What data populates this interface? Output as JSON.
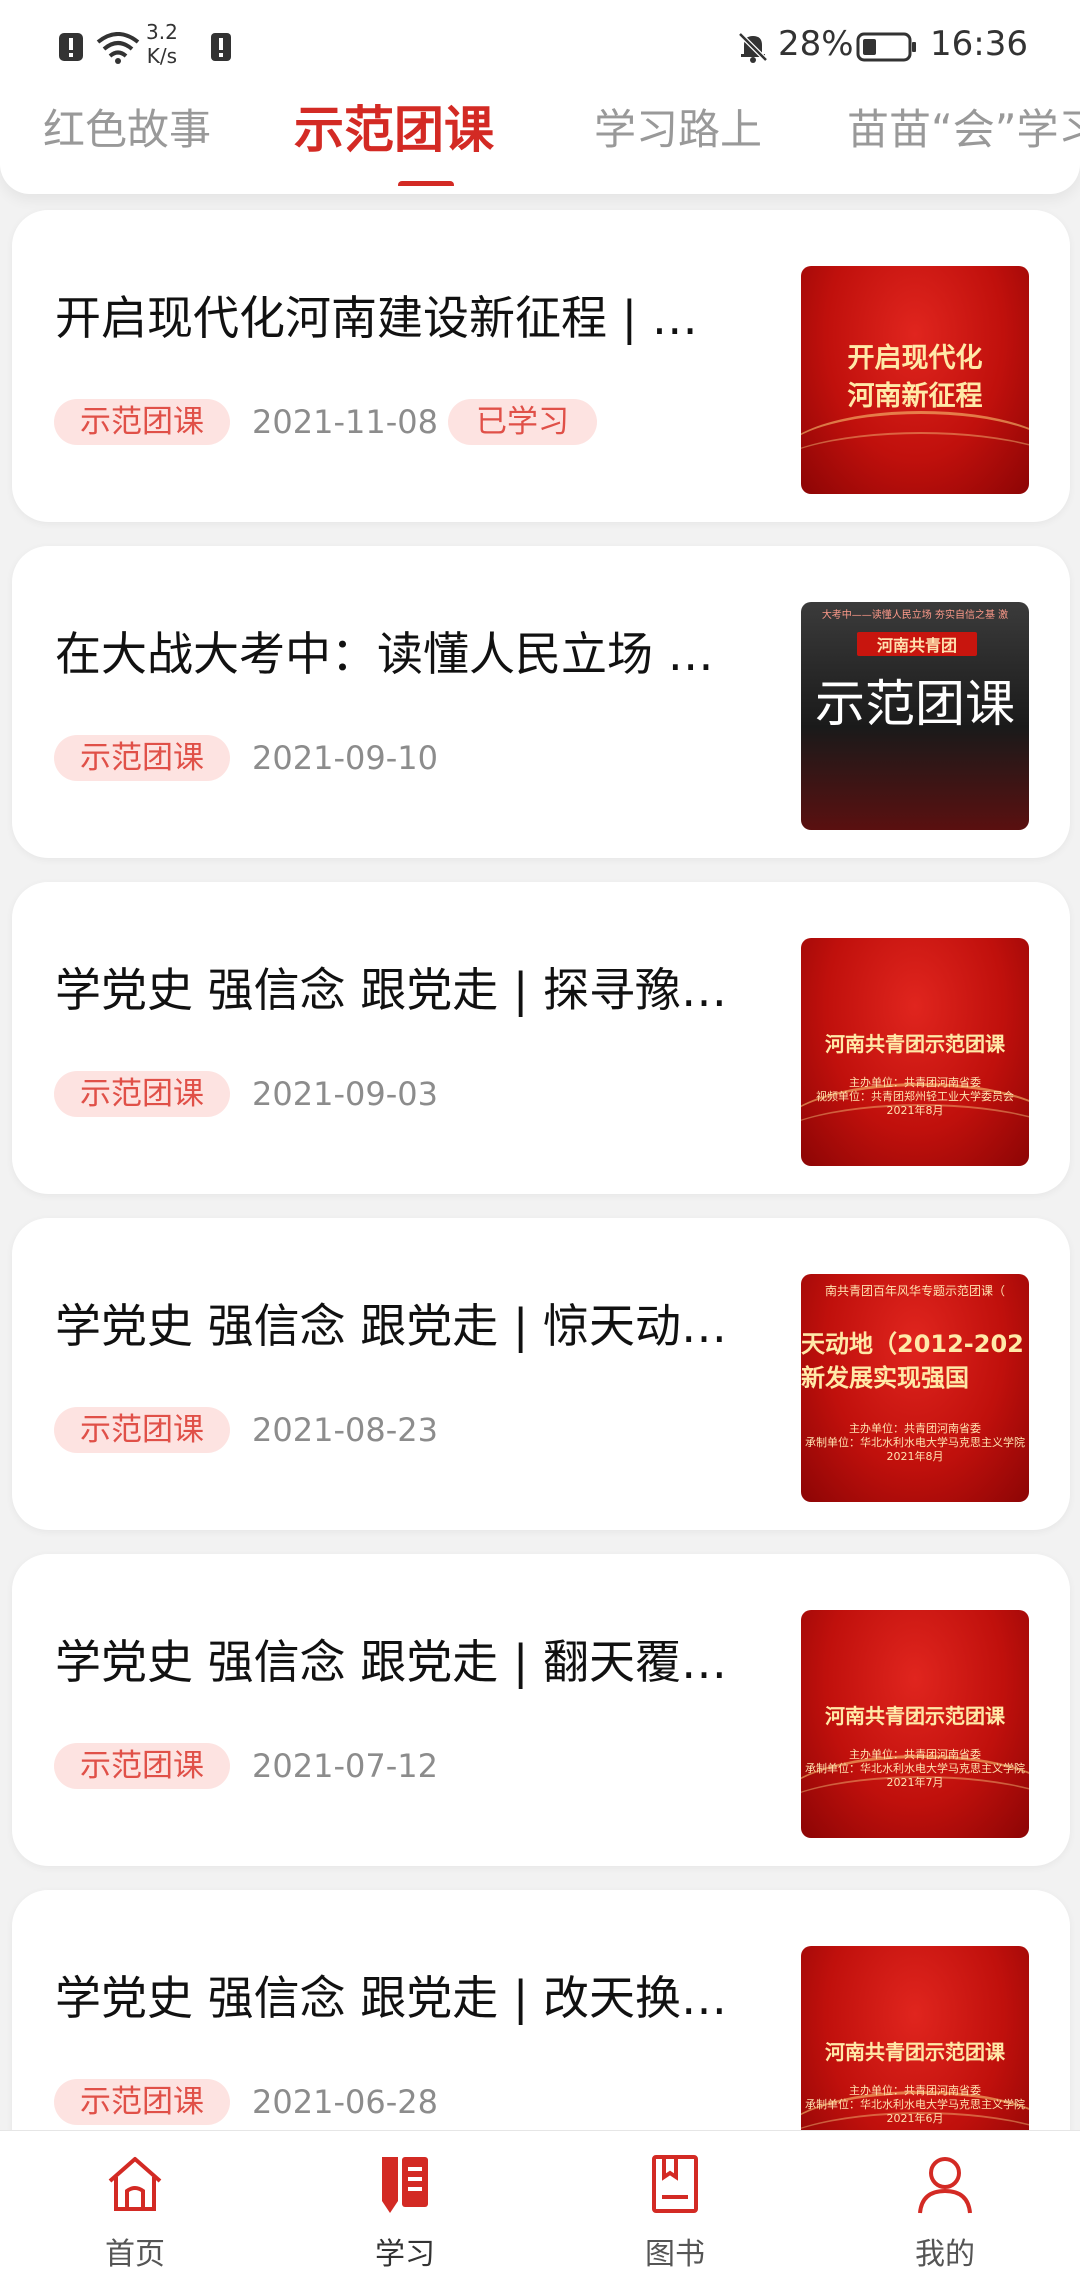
{
  "status_bar": {
    "net_speed_value": "3.2",
    "net_speed_unit": "K/s",
    "battery_percent": "28%",
    "time": "16:36"
  },
  "tabs": [
    {
      "label": "红色故事"
    },
    {
      "label": "示范团课"
    },
    {
      "label": "学习路上"
    },
    {
      "label": "苗苗“会”学习"
    }
  ],
  "active_tab_index": 1,
  "articles": [
    {
      "title": "开启现代化河南建设新征程 | …",
      "tag": "示范团课",
      "date": "2021-11-08",
      "badge": "已学习",
      "thumb": {
        "lines": [
          "开启现代化",
          "河南新征程"
        ]
      }
    },
    {
      "title": "在大战大考中：读懂人民立场 …",
      "tag": "示范团课",
      "date": "2021-09-10",
      "badge": "",
      "thumb": {
        "header": "大考中——读懂人民立场 夯实自信之基 激",
        "banner": "河南共青团",
        "big": "示范团课"
      }
    },
    {
      "title": "学党史 强信念 跟党走 | 探寻豫…",
      "tag": "示范团课",
      "date": "2021-09-03",
      "badge": "",
      "thumb": {
        "lines": [
          "河南共青团示范团课"
        ],
        "small": [
          "主办单位：共青团河南省委",
          "视频单位：共青团郑州轻工业大学委员会",
          "2021年8月"
        ]
      }
    },
    {
      "title": "学党史 强信念 跟党走 | 惊天动…",
      "tag": "示范团课",
      "date": "2021-08-23",
      "badge": "",
      "thumb": {
        "top": "南共青团百年风华专题示范团课（",
        "lines": [
          "天动地（2012-202",
          "新发展实现强国"
        ],
        "small": [
          "主办单位：共青团河南省委",
          "承制单位：华北水利水电大学马克思主义学院",
          "2021年8月"
        ]
      }
    },
    {
      "title": "学党史 强信念 跟党走 | 翻天覆…",
      "tag": "示范团课",
      "date": "2021-07-12",
      "badge": "",
      "thumb": {
        "lines": [
          "河南共青团示范团课"
        ],
        "small": [
          "主办单位：共青团河南省委",
          "承制单位：华北水利水电大学马克思主义学院",
          "2021年7月"
        ]
      }
    },
    {
      "title": "学党史 强信念 跟党走 | 改天换…",
      "tag": "示范团课",
      "date": "2021-06-28",
      "badge": "",
      "thumb": {
        "lines": [
          "河南共青团示范团课"
        ],
        "small": [
          "主办单位：共青团河南省委",
          "承制单位：华北水利水电大学马克思主义学院",
          "2021年6月"
        ]
      }
    }
  ],
  "bottom_nav": [
    {
      "label": "首页",
      "icon": "home-icon"
    },
    {
      "label": "学习",
      "icon": "study-icon"
    },
    {
      "label": "图书",
      "icon": "book-icon"
    },
    {
      "label": "我的",
      "icon": "profile-icon"
    }
  ],
  "colors": {
    "accent": "#d32a24",
    "tag_bg": "#fde3e1",
    "tag_text": "#e05048"
  }
}
